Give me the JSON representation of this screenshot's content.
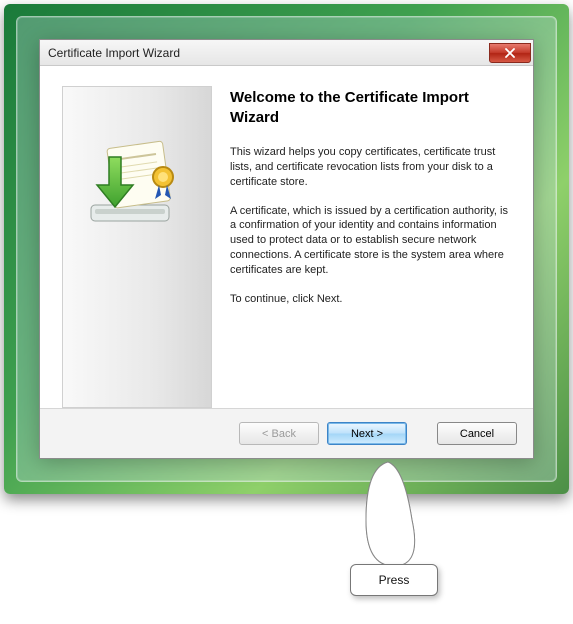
{
  "window": {
    "title": "Certificate Import Wizard"
  },
  "heading": "Welcome to the Certificate Import Wizard",
  "paragraphs": {
    "p1": "This wizard helps you copy certificates, certificate trust lists, and certificate revocation lists from your disk to a certificate store.",
    "p2": "A certificate, which is issued by a certification authority, is a confirmation of your identity and contains information used to protect data or to establish secure network connections. A certificate store is the system area where certificates are kept.",
    "p3": "To continue, click Next."
  },
  "buttons": {
    "back": "< Back",
    "next": "Next >",
    "cancel": "Cancel"
  },
  "callout": {
    "label": "Press"
  }
}
